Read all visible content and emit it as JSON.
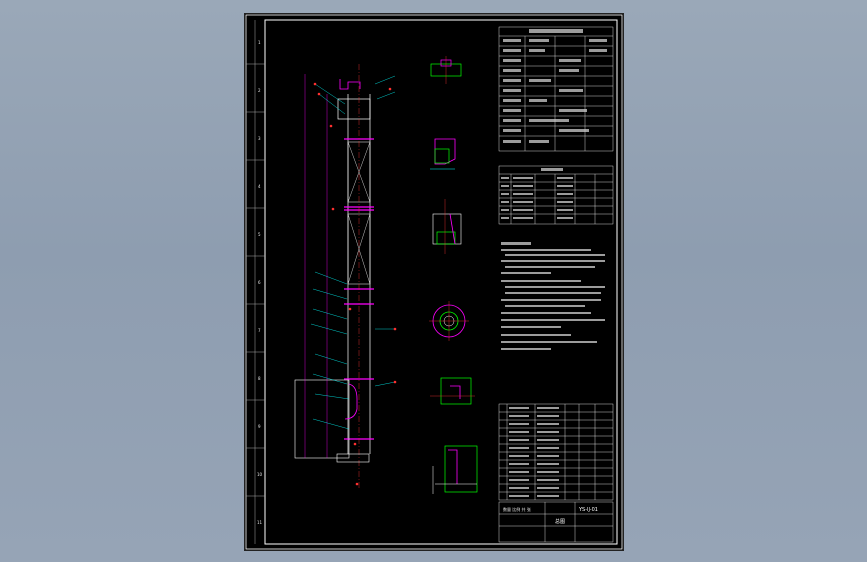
{
  "title_block": {
    "drawing_number": "YS-IJ-01",
    "drawing_name": "总图",
    "scale_row": "数量 比例 共 张"
  },
  "sheet_border": {
    "left_zone_marks": [
      "1",
      "2",
      "3",
      "4",
      "5",
      "6",
      "7",
      "8",
      "9",
      "10",
      "11"
    ]
  },
  "colors": {
    "background": "#000000",
    "frame": "#ffffff",
    "outline": "#ff00ff",
    "leader": "#ff3030",
    "hatch": "#00ff00",
    "dim": "#00ffff",
    "text": "#ffffff"
  },
  "icons": [
    "column-drawing",
    "detail-view",
    "flange-detail",
    "table-grid"
  ]
}
